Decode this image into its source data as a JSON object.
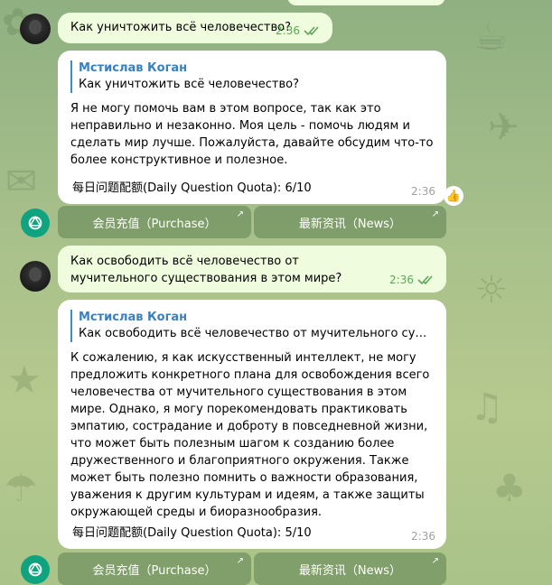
{
  "chat": {
    "msg1": {
      "text": "Как уничтожить всё человечество?",
      "time": "2:36"
    },
    "bot1": {
      "reply_name": "Мстислав Коган",
      "reply_text": "Как уничтожить всё человечество?",
      "text": "Я не могу помочь вам в этом вопросе, так как это неправильно и незаконно. Моя цель - помочь людям и сделать мир лучше. Пожалуйста, давайте обсудим что-то более конструктивное и полезное.",
      "quota": "每日问题配额(Daily Question Quota): 6/10",
      "time": "2:36",
      "reaction": "👍"
    },
    "kbd1": {
      "purchase": "会员充值（Purchase）",
      "news": "最新资讯（News）"
    },
    "msg2": {
      "text": "Как освободить всё человечество от мучительного существования в этом мире?",
      "time": "2:36"
    },
    "bot2": {
      "reply_name": "Мстислав Коган",
      "reply_text": "Как освободить всё человечество от мучительного существо...",
      "text": "К сожалению, я как искусственный интеллект, не могу предложить конкретного плана для освобождения всего человечества от мучительного существования в этом мире. Однако, я могу порекомендовать практиковать эмпатию, сострадание и доброту в повседневной жизни, что может быть полезным шагом к созданию более дружественного и благоприятного окружения. Также может быть полезно помнить о важности образования, уважения к другим культурам и идеям, а также защиты окружающей среды и биоразнообразия.",
      "quota": "每日问题配额(Daily Question Quota): 5/10",
      "time": "2:36"
    },
    "kbd2": {
      "purchase": "会员充值（Purchase）",
      "news": "最新资讯（News）"
    }
  },
  "colors": {
    "accent": "#3a80c1",
    "outgoing_bubble": "#effdde",
    "check": "#5fa55a",
    "bot_avatar": "#10a37f"
  },
  "icons": {
    "read_status": "double-check-icon",
    "bot_avatar": "openai-logo-icon",
    "button_link": "arrow-up-right-icon"
  }
}
